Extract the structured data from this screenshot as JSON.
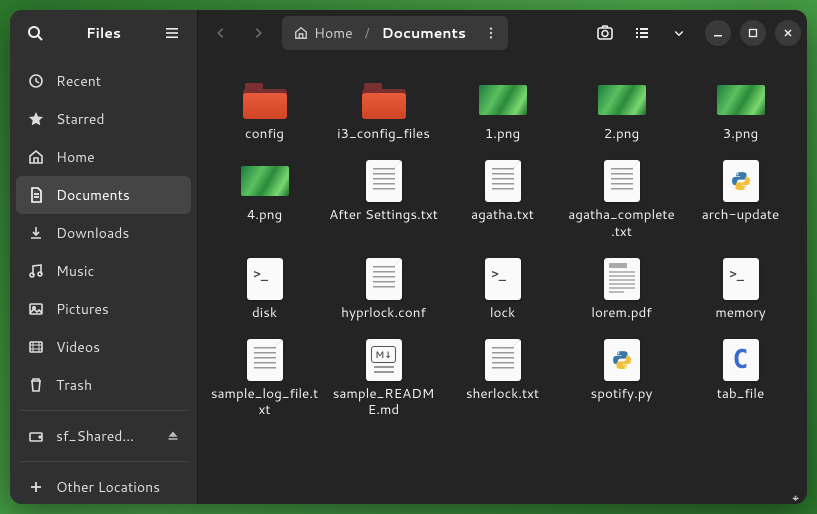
{
  "app_title": "Files",
  "sidebar": {
    "items": [
      {
        "icon": "recent",
        "label": "Recent"
      },
      {
        "icon": "starred",
        "label": "Starred"
      },
      {
        "icon": "home",
        "label": "Home"
      },
      {
        "icon": "documents",
        "label": "Documents",
        "active": true
      },
      {
        "icon": "downloads",
        "label": "Downloads"
      },
      {
        "icon": "music",
        "label": "Music"
      },
      {
        "icon": "pictures",
        "label": "Pictures"
      },
      {
        "icon": "videos",
        "label": "Videos"
      },
      {
        "icon": "trash",
        "label": "Trash"
      }
    ],
    "mounts": [
      {
        "icon": "drive",
        "label": "sf_Shared…",
        "ejectable": true
      }
    ],
    "other_locations_label": "Other Locations"
  },
  "path": {
    "segments": [
      {
        "icon": "home",
        "label": "Home"
      },
      {
        "label": "Documents",
        "current": true
      }
    ]
  },
  "files": [
    {
      "name": "config",
      "type": "folder"
    },
    {
      "name": "i3_config_files",
      "type": "folder"
    },
    {
      "name": "1.png",
      "type": "image"
    },
    {
      "name": "2.png",
      "type": "image"
    },
    {
      "name": "3.png",
      "type": "image"
    },
    {
      "name": "4.png",
      "type": "image"
    },
    {
      "name": "After Settings.txt",
      "type": "text"
    },
    {
      "name": "agatha.txt",
      "type": "text"
    },
    {
      "name": "agatha_complete.txt",
      "type": "text"
    },
    {
      "name": "arch-update",
      "type": "python"
    },
    {
      "name": "disk",
      "type": "script"
    },
    {
      "name": "hyprlock.conf",
      "type": "text"
    },
    {
      "name": "lock",
      "type": "script"
    },
    {
      "name": "lorem.pdf",
      "type": "pdf"
    },
    {
      "name": "memory",
      "type": "script"
    },
    {
      "name": "sample_log_file.txt",
      "type": "text"
    },
    {
      "name": "sample_README.md",
      "type": "markdown"
    },
    {
      "name": "sherlock.txt",
      "type": "text"
    },
    {
      "name": "spotify.py",
      "type": "python"
    },
    {
      "name": "tab_file",
      "type": "c"
    }
  ]
}
